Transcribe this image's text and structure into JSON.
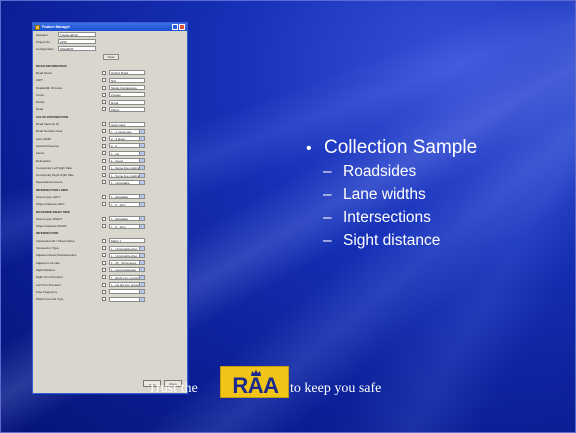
{
  "window": {
    "title": "Feature Manager",
    "header_fields": [
      {
        "label": "Operator",
        "value": "Transit admin"
      },
      {
        "label": "Project No",
        "value": "2150"
      },
      {
        "label": "Configuration",
        "value": "SIGAROF"
      }
    ],
    "clear_label": "Clear",
    "rows": [
      {
        "label": "ROAD INFORMATION",
        "section": true
      },
      {
        "label": "Road Name",
        "value": "Oxford Road",
        "dd": false
      },
      {
        "label": "UNIT",
        "value": "N/A",
        "dd": false
      },
      {
        "label": "Roadwidth W metre",
        "value": "Single Carriageway",
        "dd": false
      },
      {
        "label": "Cross",
        "value": "2 lanes",
        "dd": false
      },
      {
        "label": "Divide",
        "value": "Rural",
        "dd": false
      },
      {
        "label": "Node",
        "value": "Plains",
        "dd": false
      },
      {
        "label": "VALUE DISTRIBUTION",
        "section": true
      },
      {
        "label": "Road Verbone W",
        "value": "Apply Now",
        "dd": false
      },
      {
        "label": "Road Number Clear",
        "value": "1 - 2 metre way",
        "dd": true
      },
      {
        "label": "Lane Width",
        "value": "2 - 3 lanes",
        "dd": true
      },
      {
        "label": "Hazard Presence",
        "value": "2 - 4",
        "dd": true
      },
      {
        "label": "Fence",
        "value": "1 - No",
        "dd": true
      },
      {
        "label": "Delineation",
        "value": "1 - Good",
        "dd": true
      },
      {
        "label": "Conspicuity Left Sight Side",
        "value": "1 - Some line markings",
        "dd": true
      },
      {
        "label": "Conspicuity Right Sight Side",
        "value": "1 - Some line markings",
        "dd": true
      },
      {
        "label": "Speed Environment",
        "value": "1 - Unsuitable",
        "dd": true
      },
      {
        "label": "INTERSECTION LINES",
        "section": true
      },
      {
        "label": "Severe type LEFT",
        "value": "1 - Roadside",
        "dd": true
      },
      {
        "label": "Object distance LEFT",
        "value": "1 - 5 - 10m",
        "dd": true
      },
      {
        "label": "ROADSIDE RIGHT SIDE",
        "section": true
      },
      {
        "label": "Severe type RIGHT",
        "value": "1 - Roadside",
        "dd": true
      },
      {
        "label": "Object distance RIGHT",
        "value": "1 - 5 - 10m",
        "dd": true
      },
      {
        "label": "INTERSECTION",
        "section": true
      },
      {
        "label": "Intersection ID / Street Name",
        "value": "Major 1",
        "dd": false
      },
      {
        "label": "Intersection Type",
        "value": "1 - Unsignalized leg",
        "dd": true
      },
      {
        "label": "Adjacent Road Characteristics",
        "value": "1 - Unsignalized leg",
        "dd": true
      },
      {
        "label": "Adjacent Left side",
        "value": "1 - 25 - 90 degrees",
        "dd": true
      },
      {
        "label": "Sight Distance",
        "value": "1 - Good adequate",
        "dd": true
      },
      {
        "label": "Right Turn Provision",
        "value": "1 - Right turn provision",
        "dd": true
      },
      {
        "label": "Left Turn Provision",
        "value": "1 - No left turn provision",
        "dd": true
      },
      {
        "label": "Free Frequency",
        "value": "",
        "dd": true
      },
      {
        "label": "Pattern Control Type",
        "value": "",
        "dd": true
      }
    ],
    "apply_label": "Apply",
    "close_label": "Close"
  },
  "bullets": {
    "main": "Collection Sample",
    "items": [
      "Roadsides",
      "Lane widths",
      "Intersections",
      "Sight distance"
    ]
  },
  "footer": {
    "left": "Trust the",
    "logo": "RAA",
    "right": "to keep you safe"
  },
  "colors": {
    "background": "#0b1f96",
    "text": "#ffffff",
    "logo_bg": "#f3c418",
    "logo_text": "#1b2a8c"
  }
}
